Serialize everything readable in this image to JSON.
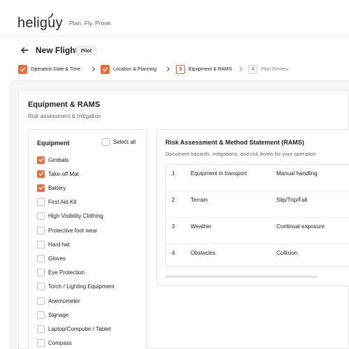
{
  "brand": {
    "name": "heliguy",
    "tagline": "Plan. Fly. Prove."
  },
  "header": {
    "title": "New Flight",
    "badge": "Pilot"
  },
  "steps": [
    {
      "number": "1",
      "label": "Operation Date & Time",
      "status": "done"
    },
    {
      "number": "2",
      "label": "Location & Planning",
      "status": "done"
    },
    {
      "number": "3",
      "label": "Equipment & RAMS",
      "status": "current"
    },
    {
      "number": "4",
      "label": "Plan Review",
      "status": "todo"
    }
  ],
  "section": {
    "title": "Equipment & RAMS",
    "subtitle": "Risk assessment & mitigation"
  },
  "equipment": {
    "title": "Equipment",
    "select_all_label": "Select all",
    "items": [
      {
        "label": "Gimbals",
        "checked": true
      },
      {
        "label": "Take-off Mat",
        "checked": true
      },
      {
        "label": "Battery",
        "checked": true
      },
      {
        "label": "First Aid Kit",
        "checked": false
      },
      {
        "label": "High Visibility Clothing",
        "checked": false
      },
      {
        "label": "Protective foot wear",
        "checked": false
      },
      {
        "label": "Hard hat",
        "checked": false
      },
      {
        "label": "Gloves",
        "checked": false
      },
      {
        "label": "Eye Protection",
        "checked": false
      },
      {
        "label": "Torch / Lighting Equipment",
        "checked": false
      },
      {
        "label": "Anemometer",
        "checked": false
      },
      {
        "label": "Signage",
        "checked": false
      },
      {
        "label": "Laptop/Computer / Tablet",
        "checked": false
      },
      {
        "label": "Compass",
        "checked": false
      }
    ]
  },
  "rams": {
    "title": "Risk Assessment & Method Statement (RAMS)",
    "subtitle": "Document hazards, mitigations, and risk levels for your operation",
    "rows": [
      {
        "num": "1",
        "hazard": "Equipment in transport",
        "risk": "Manual handling"
      },
      {
        "num": "2",
        "hazard": "Terrain",
        "risk": "Slip/Trip/Fall"
      },
      {
        "num": "3",
        "hazard": "Weather",
        "risk": "Continual exposure"
      },
      {
        "num": "4",
        "hazard": "Obstacles",
        "risk": "Collision"
      }
    ]
  },
  "colors": {
    "accent": "#f26b3a",
    "background": "#f6f6f4"
  }
}
